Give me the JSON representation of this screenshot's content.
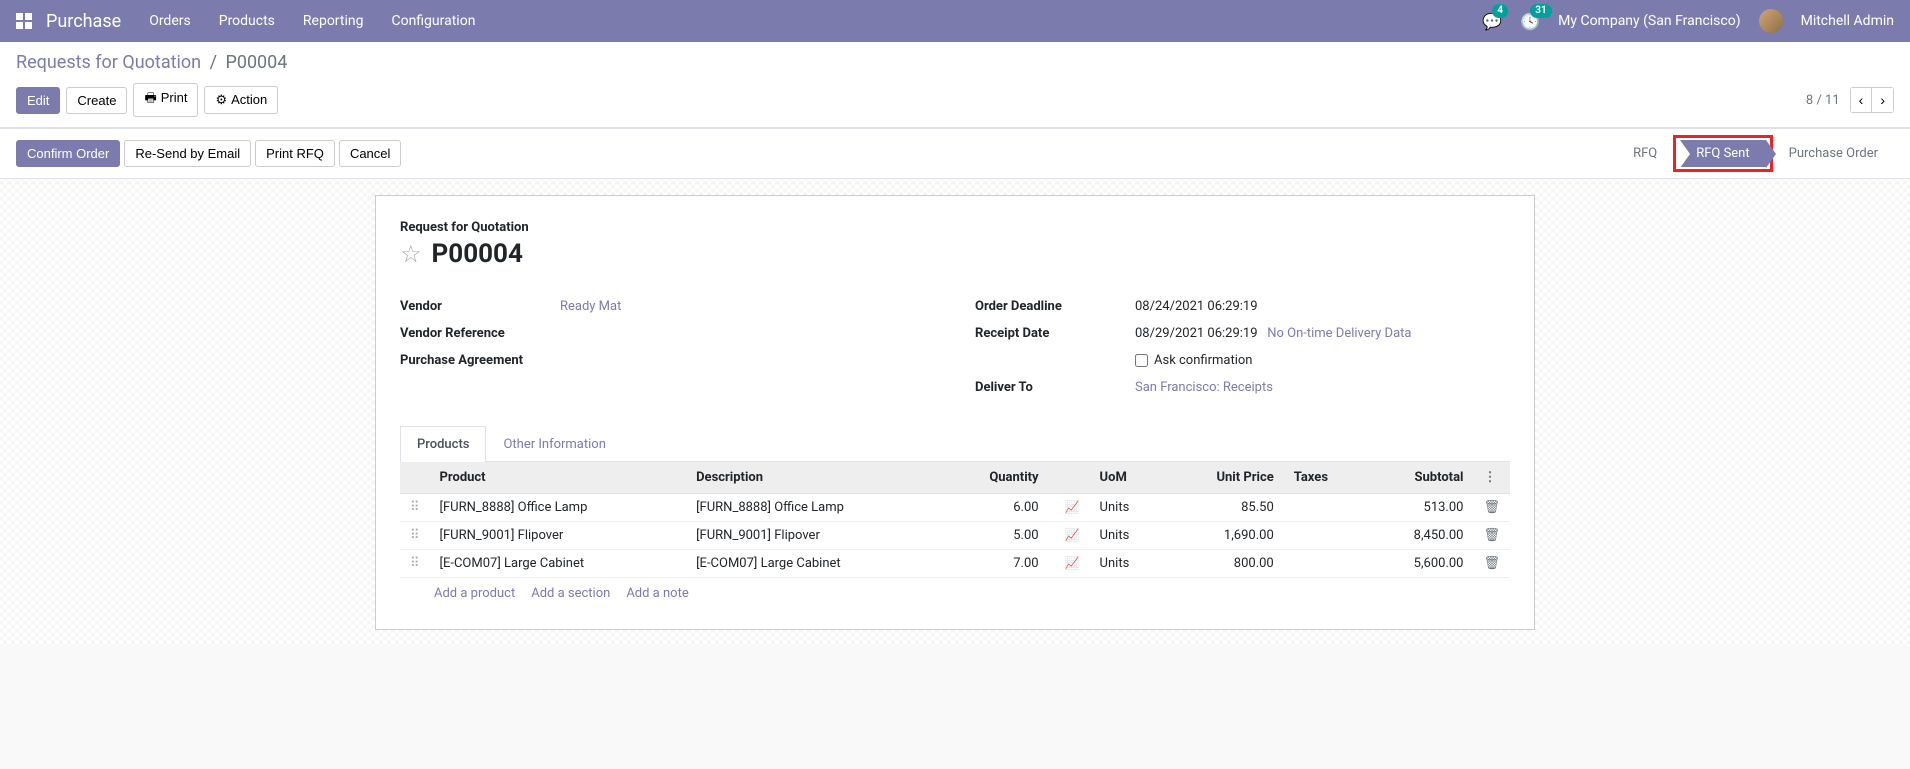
{
  "topnav": {
    "brand": "Purchase",
    "menu": [
      "Orders",
      "Products",
      "Reporting",
      "Configuration"
    ],
    "chat_badge": "4",
    "activity_badge": "31",
    "company": "My Company (San Francisco)",
    "user": "Mitchell Admin"
  },
  "breadcrumb": {
    "parent": "Requests for Quotation",
    "current": "P00004"
  },
  "buttons": {
    "edit": "Edit",
    "create": "Create",
    "print": "Print",
    "action": "Action",
    "confirm": "Confirm Order",
    "resend": "Re-Send by Email",
    "print_rfq": "Print RFQ",
    "cancel": "Cancel"
  },
  "pager": {
    "pos": "8 / 11"
  },
  "status": {
    "steps": [
      {
        "label": "RFQ",
        "active": false
      },
      {
        "label": "RFQ Sent",
        "active": true
      },
      {
        "label": "Purchase Order",
        "active": false
      }
    ]
  },
  "title": {
    "label": "Request for Quotation",
    "name": "P00004"
  },
  "fields_left": {
    "vendor_label": "Vendor",
    "vendor_value": "Ready Mat",
    "vendor_ref_label": "Vendor Reference",
    "vendor_ref_value": "",
    "agreement_label": "Purchase Agreement",
    "agreement_value": ""
  },
  "fields_right": {
    "deadline_label": "Order Deadline",
    "deadline_value": "08/24/2021 06:29:19",
    "receipt_label": "Receipt Date",
    "receipt_value": "08/29/2021 06:29:19",
    "receipt_link": "No On-time Delivery Data",
    "ask_confirm": "Ask confirmation",
    "deliver_label": "Deliver To",
    "deliver_value": "San Francisco: Receipts"
  },
  "tabs": {
    "products": "Products",
    "other": "Other Information"
  },
  "table": {
    "headers": {
      "product": "Product",
      "description": "Description",
      "quantity": "Quantity",
      "uom": "UoM",
      "unit_price": "Unit Price",
      "taxes": "Taxes",
      "subtotal": "Subtotal"
    },
    "rows": [
      {
        "product": "[FURN_8888] Office Lamp",
        "description": "[FURN_8888] Office Lamp",
        "quantity": "6.00",
        "uom": "Units",
        "unit_price": "85.50",
        "taxes": "",
        "subtotal": "513.00"
      },
      {
        "product": "[FURN_9001] Flipover",
        "description": "[FURN_9001] Flipover",
        "quantity": "5.00",
        "uom": "Units",
        "unit_price": "1,690.00",
        "taxes": "",
        "subtotal": "8,450.00"
      },
      {
        "product": "[E-COM07] Large Cabinet",
        "description": "[E-COM07] Large Cabinet",
        "quantity": "7.00",
        "uom": "Units",
        "unit_price": "800.00",
        "taxes": "",
        "subtotal": "5,600.00"
      }
    ],
    "add_product": "Add a product",
    "add_section": "Add a section",
    "add_note": "Add a note"
  }
}
